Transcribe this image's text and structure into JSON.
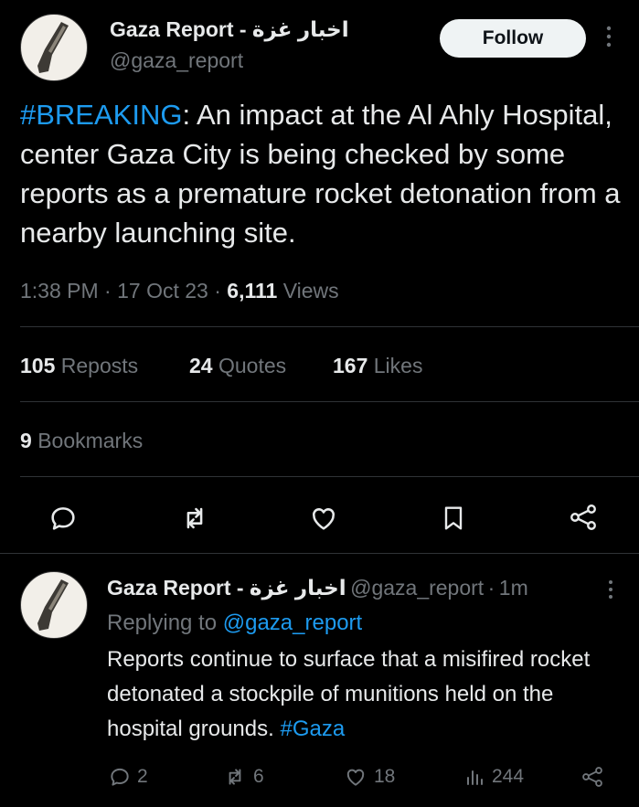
{
  "tweet": {
    "author_name": "Gaza Report - اخبار غزة",
    "author_handle": "@gaza_report",
    "follow_label": "Follow",
    "text_hashtag": "#BREAKING",
    "text_body": ": An impact at the Al Ahly Hospital, center Gaza City is being checked by some reports as a premature rocket detonation from a nearby launching site.",
    "time": "1:38 PM",
    "sep": "·",
    "date": "17 Oct 23",
    "views_count": "6,111",
    "views_label": "Views",
    "reposts_count": "105",
    "reposts_label": "Reposts",
    "quotes_count": "24",
    "quotes_label": "Quotes",
    "likes_count": "167",
    "likes_label": "Likes",
    "bookmarks_count": "9",
    "bookmarks_label": "Bookmarks",
    "actions": [
      "reply-icon",
      "repost-icon",
      "like-icon",
      "bookmark-icon",
      "share-icon"
    ]
  },
  "reply": {
    "author_name": "Gaza Report - اخبار غزة",
    "author_handle": "@gaza_report",
    "sep": "·",
    "age": "1m",
    "replying_label": "Replying to",
    "replying_handle": "@gaza_report",
    "text_body": "Reports continue to surface that a misifired rocket detonated a stockpile of munitions held on the hospital grounds.",
    "text_hashtag": "#Gaza",
    "replies": "2",
    "reposts": "6",
    "likes": "18",
    "views": "244"
  },
  "colors": {
    "background": "#000000",
    "text": "#e7e9ea",
    "muted": "#71767b",
    "accent": "#1d9bf0",
    "divider": "#2f3336"
  }
}
